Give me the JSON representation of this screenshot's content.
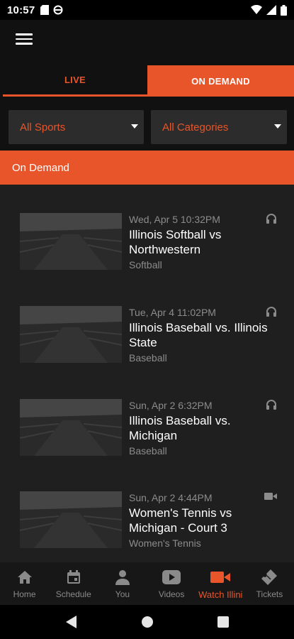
{
  "status_bar": {
    "time": "10:57"
  },
  "tabs": [
    {
      "label": "LIVE"
    },
    {
      "label": "ON DEMAND"
    }
  ],
  "filters": {
    "sports": "All Sports",
    "categories": "All Categories"
  },
  "section_title": "On Demand",
  "items": [
    {
      "date": "Wed, Apr 5 10:32PM",
      "title": "Illinois Softball vs Northwestern",
      "sport": "Softball",
      "media": "headphones-icon"
    },
    {
      "date": "Tue, Apr 4 11:02PM",
      "title": "Illinois Baseball vs. Illinois State",
      "sport": "Baseball",
      "media": "headphones-icon"
    },
    {
      "date": "Sun, Apr 2 6:32PM",
      "title": "Illinois Baseball vs. Michigan",
      "sport": "Baseball",
      "media": "headphones-icon"
    },
    {
      "date": "Sun, Apr 2 4:44PM",
      "title": "Women's Tennis vs Michigan - Court 3",
      "sport": "Women's Tennis",
      "media": "video-camera-icon"
    }
  ],
  "bottom_nav": [
    {
      "label": "Home",
      "icon": "home-icon"
    },
    {
      "label": "Schedule",
      "icon": "calendar-icon"
    },
    {
      "label": "You",
      "icon": "person-icon"
    },
    {
      "label": "Videos",
      "icon": "play-icon"
    },
    {
      "label": "Watch Illini",
      "icon": "video-camera-icon",
      "active": true
    },
    {
      "label": "Tickets",
      "icon": "ticket-icon"
    }
  ],
  "colors": {
    "accent": "#e8552a",
    "background": "#1f1f1f",
    "muted_text": "#8c8c8c"
  }
}
